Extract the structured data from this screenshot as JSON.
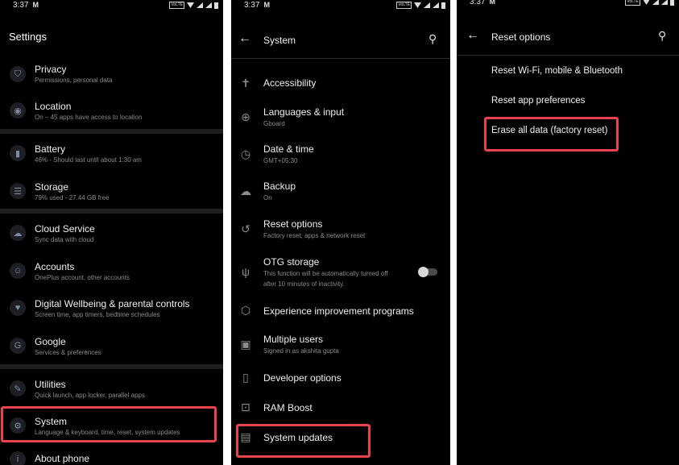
{
  "status": {
    "time": "3:37",
    "carrier_glyph": "M",
    "volte": "VoLTE"
  },
  "panel1": {
    "title": "Settings",
    "items": [
      {
        "title": "Privacy",
        "subtitle": "Permissions, personal data",
        "icon": "shield-icon"
      },
      {
        "title": "Location",
        "subtitle": "On – 45 apps have access to location",
        "icon": "location-pin-icon"
      },
      {
        "title": "Battery",
        "subtitle": "46% - Should last until about 1:30 am",
        "icon": "battery-icon"
      },
      {
        "title": "Storage",
        "subtitle": "79% used - 27.44 GB free",
        "icon": "storage-icon"
      },
      {
        "title": "Cloud Service",
        "subtitle": "Sync data with cloud",
        "icon": "cloud-icon"
      },
      {
        "title": "Accounts",
        "subtitle": "OnePlus account, other accounts",
        "icon": "account-icon"
      },
      {
        "title": "Digital Wellbeing & parental controls",
        "subtitle": "Screen time, app timers, bedtime schedules",
        "icon": "wellbeing-icon"
      },
      {
        "title": "Google",
        "subtitle": "Services & preferences",
        "icon": "google-icon"
      },
      {
        "title": "Utilities",
        "subtitle": "Quick launch, app locker, parallel apps",
        "icon": "utilities-icon"
      },
      {
        "title": "System",
        "subtitle": "Language & keyboard, time, reset, system updates",
        "icon": "gear-icon"
      },
      {
        "title": "About phone",
        "subtitle": "",
        "icon": "info-icon"
      }
    ]
  },
  "panel2": {
    "title": "System",
    "items": [
      {
        "title": "Accessibility",
        "subtitle": "",
        "icon": "accessibility-icon"
      },
      {
        "title": "Languages & input",
        "subtitle": "Gboard",
        "icon": "globe-icon"
      },
      {
        "title": "Date & time",
        "subtitle": "GMT+05:30",
        "icon": "clock-icon"
      },
      {
        "title": "Backup",
        "subtitle": "On",
        "icon": "cloud-backup-icon"
      },
      {
        "title": "Reset options",
        "subtitle": "Factory reset, apps & network reset",
        "icon": "history-icon"
      },
      {
        "title": "OTG storage",
        "subtitle": "This function will be automatically turned off",
        "subtitle2": "after 10 minutes of inactivity.",
        "icon": "usb-icon"
      },
      {
        "title": "Experience improvement programs",
        "subtitle": "",
        "icon": "chart-icon"
      },
      {
        "title": "Multiple users",
        "subtitle": "Signed in as akshita gupta",
        "icon": "users-icon"
      },
      {
        "title": "Developer options",
        "subtitle": "",
        "icon": "phone-icon"
      },
      {
        "title": "RAM Boost",
        "subtitle": "",
        "icon": "ram-icon"
      },
      {
        "title": "System updates",
        "subtitle": "",
        "icon": "system-update-icon"
      }
    ]
  },
  "panel3": {
    "title": "Reset options",
    "items": [
      {
        "title": "Reset Wi-Fi, mobile & Bluetooth"
      },
      {
        "title": "Reset app preferences"
      },
      {
        "title": "Erase all data (factory reset)"
      }
    ]
  },
  "colors": {
    "highlight": "#e8424b",
    "background": "#000000",
    "icon_circle": "#1d1f24"
  }
}
